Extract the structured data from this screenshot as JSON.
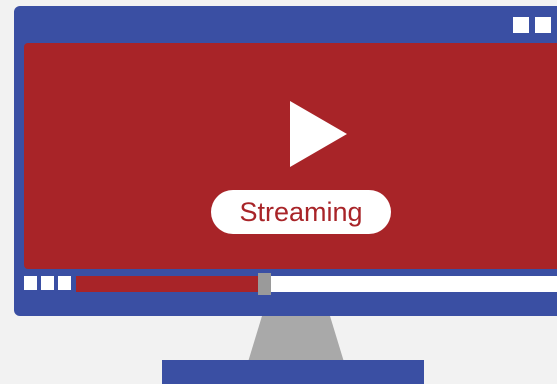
{
  "screen": {
    "badge_label": "Streaming",
    "colors": {
      "frame": "#3a4fa3",
      "screen": "#a82428",
      "white": "#ffffff",
      "stand": "#a9a9a9",
      "background": "#f2f2f2"
    }
  },
  "player": {
    "progress": 0.37
  },
  "icons": {
    "play": "play-icon",
    "window_controls": "window-control-icons",
    "player_controls": "player-control-icons"
  }
}
